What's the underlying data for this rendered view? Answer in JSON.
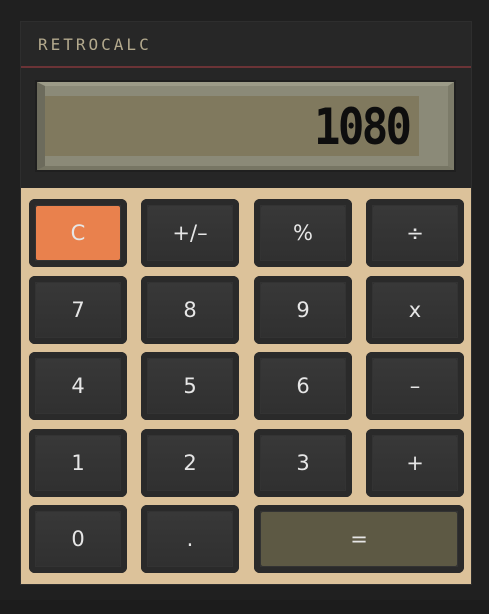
{
  "app": {
    "brand": "RETROCALC"
  },
  "display": {
    "value": "1080"
  },
  "keys": {
    "clear": "C",
    "sign": "+/–",
    "percent": "%",
    "divide": "÷",
    "seven": "7",
    "eight": "8",
    "nine": "9",
    "multiply": "x",
    "four": "4",
    "five": "5",
    "six": "6",
    "minus": "–",
    "one": "1",
    "two": "2",
    "three": "3",
    "plus": "+",
    "zero": "0",
    "decimal": ".",
    "equals": "="
  },
  "colors": {
    "keypad_bg": "#dcc29a",
    "clear_key": "#e9814d",
    "equals_key": "#5d5944",
    "lcd_bg": "#80795e",
    "accent_line": "#6b3336"
  }
}
